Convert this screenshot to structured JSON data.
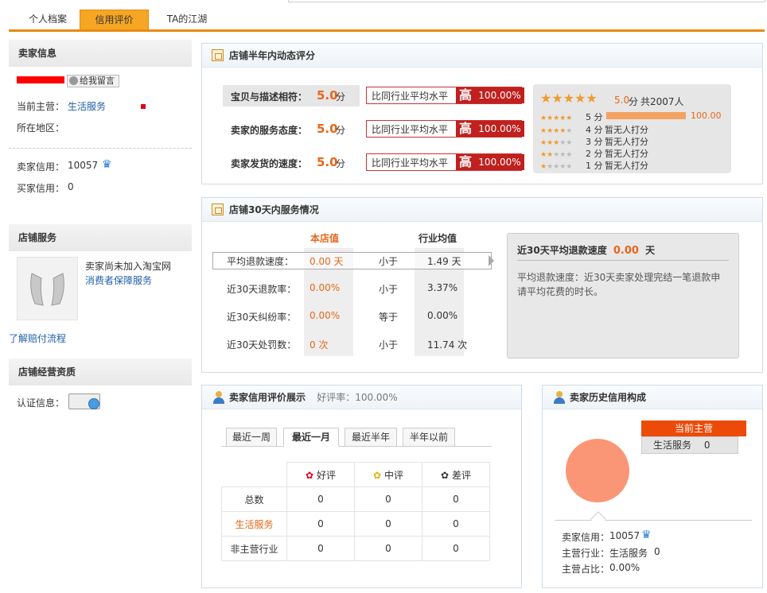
{
  "tabs": [
    {
      "label": "个人档案"
    },
    {
      "label": "信用评价"
    },
    {
      "label": "TA的江湖"
    }
  ],
  "seller": {
    "header": "卖家信息",
    "leave_msg": "给我留言",
    "main_business_label": "当前主营：",
    "main_business_value": "生活服务",
    "region_label": "所在地区：",
    "credit_label": "卖家信用：",
    "credit_value": "10057",
    "buyer_credit_label": "买家信用：",
    "buyer_credit_value": "0"
  },
  "shop_service": {
    "header": "店铺服务",
    "note": "卖家尚未加入淘宝网",
    "link": "消费者保障服务",
    "claim_link": "了解赔付流程"
  },
  "shop_qual": {
    "header": "店铺经营资质",
    "cert_label": "认证信息："
  },
  "dsr": {
    "title": "店铺半年内动态评分",
    "rows": [
      {
        "label": "宝贝与描述相符：",
        "score": "5.0",
        "unit": "分",
        "compare": "比同行业平均水平",
        "level": "高",
        "pct": "100.00%"
      },
      {
        "label": "卖家的服务态度：",
        "score": "5.0",
        "unit": "分",
        "compare": "比同行业平均水平",
        "level": "高",
        "pct": "100.00%"
      },
      {
        "label": "卖家发货的速度：",
        "score": "5.0",
        "unit": "分",
        "compare": "比同行业平均水平",
        "level": "高",
        "pct": "100.00%"
      }
    ],
    "summary_score": "5.0",
    "summary_unit": "分",
    "summary_total": "共2007人",
    "dist": [
      {
        "stars": 5,
        "label": "5 分",
        "text": "",
        "pct_label": "100.00",
        "fraction": 1.0
      },
      {
        "stars": 4,
        "label": "4 分",
        "text": "暂无人打分"
      },
      {
        "stars": 3,
        "label": "3 分",
        "text": "暂无人打分"
      },
      {
        "stars": 2,
        "label": "2 分",
        "text": "暂无人打分"
      },
      {
        "stars": 1,
        "label": "1 分",
        "text": "暂无人打分"
      }
    ]
  },
  "service30": {
    "title": "店铺30天内服务情况",
    "col_store": "本店值",
    "col_industry": "行业均值",
    "rows": [
      {
        "label": "平均退款速度：",
        "store": "0.00 天",
        "cmp": "小于",
        "industry": "1.49 天"
      },
      {
        "label": "近30天退款率：",
        "store": "0.00%",
        "cmp": "小于",
        "industry": "3.37%"
      },
      {
        "label": "近30天纠纷率：",
        "store": "0.00%",
        "cmp": "等于",
        "industry": "0.00%"
      },
      {
        "label": "近30天处罚数：",
        "store": "0 次",
        "cmp": "小于",
        "industry": "11.74 次"
      }
    ],
    "box_title_prefix": "近30天平均退款速度",
    "box_value": "0.00",
    "box_unit": "天",
    "box_desc": "平均退款速度：近30天卖家处理完结一笔退款申请平均花费的时长。"
  },
  "credit_show": {
    "title": "卖家信用评价展示",
    "good_rate": "好评率：100.00%",
    "tabs": [
      "最近一周",
      "最近一月",
      "最近半年",
      "半年以前"
    ],
    "headers": [
      "好评",
      "中评",
      "差评"
    ],
    "rows": [
      {
        "label": "总数",
        "values": [
          "0",
          "0",
          "0"
        ]
      },
      {
        "label": "生活服务",
        "values": [
          "0",
          "0",
          "0"
        ]
      },
      {
        "label": "非主营行业",
        "values": [
          "0",
          "0",
          "0"
        ]
      }
    ]
  },
  "history": {
    "title": "卖家历史信用构成",
    "badge": "当前主营",
    "item": "生活服务",
    "item_value": "0",
    "credit_label": "卖家信用：",
    "credit_value": "10057",
    "industry_label": "主营行业：",
    "industry_value": "生活服务",
    "industry_count": "0",
    "ratio_label": "主营占比：",
    "ratio_value": "0.00%"
  },
  "colors": {
    "accent": "#e88a10",
    "high": "#c0201e",
    "orange_text": "#e8661a",
    "pie": "#fa9676"
  }
}
